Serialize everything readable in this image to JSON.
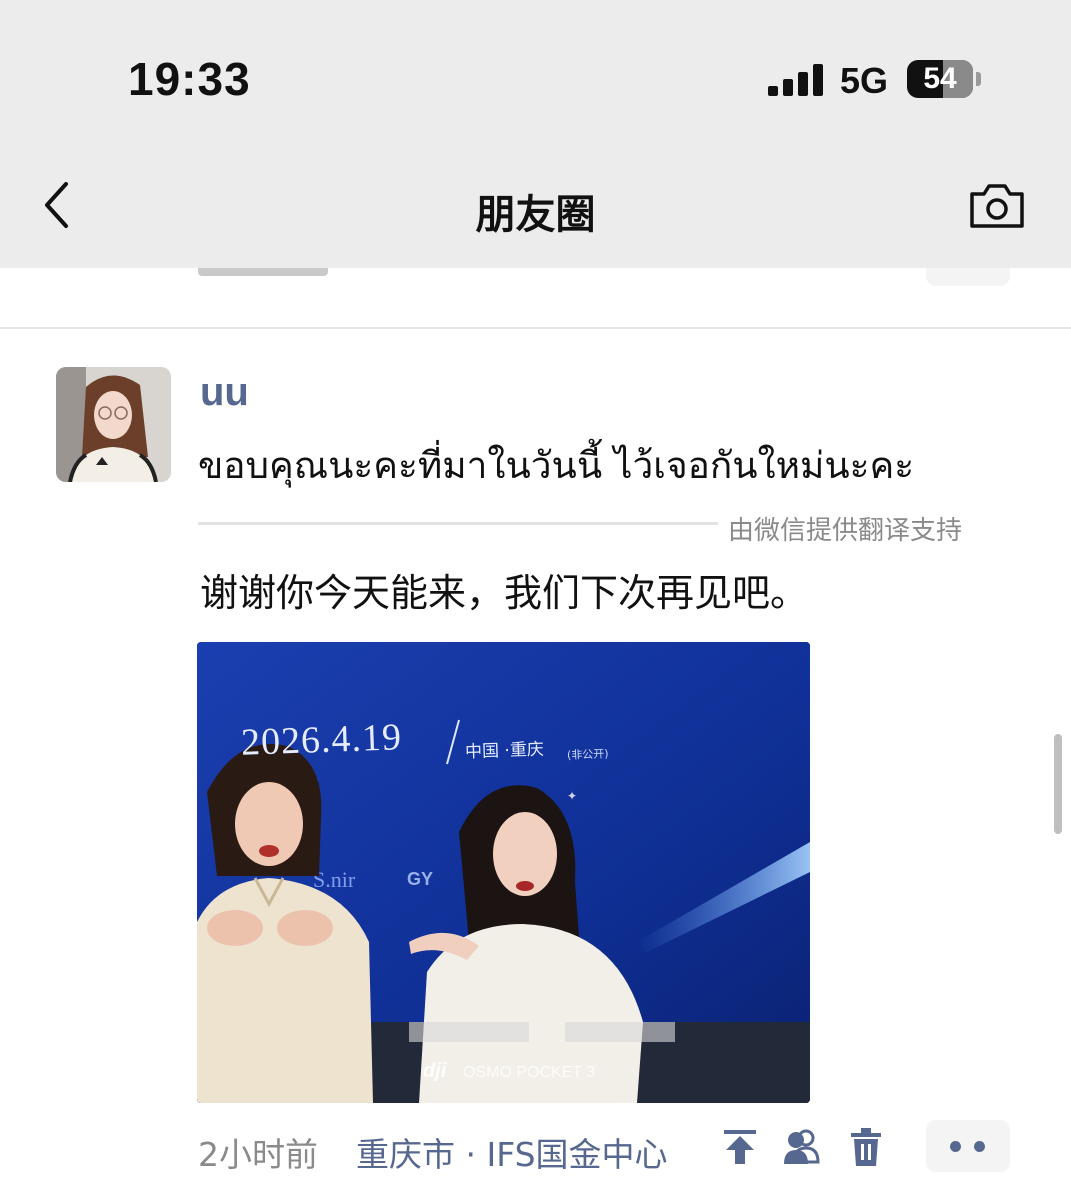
{
  "status_bar": {
    "time": "19:33",
    "network": "5G",
    "battery_level": "54",
    "battery_fraction": 0.54
  },
  "header": {
    "title": "朋友圈",
    "back_icon": "chevron-left-icon",
    "camera_icon": "camera-icon"
  },
  "post": {
    "username": "uu",
    "text": "ขอบคุณนะคะที่มาในวันนี้ ไว้เจอกันใหม่นะคะ",
    "translation_credit": "由微信提供翻译支持",
    "translated_text": "谢谢你今天能来，我们下次再见吧。",
    "photo": {
      "date": "2026.4.19",
      "location": "中国 ·重庆",
      "location_note": "(非公开)",
      "watermark_brand": "dji",
      "watermark_product": "OSMO POCKET 3"
    },
    "time": "2小时前",
    "location": "重庆市 · IFS国金中心",
    "actions": [
      "share-icon",
      "visible-to-icon",
      "trash-icon",
      "more-icon"
    ]
  },
  "colors": {
    "link_blue": "#56688f",
    "header_bg": "#ececec",
    "photo_bg": "#1238a8"
  }
}
